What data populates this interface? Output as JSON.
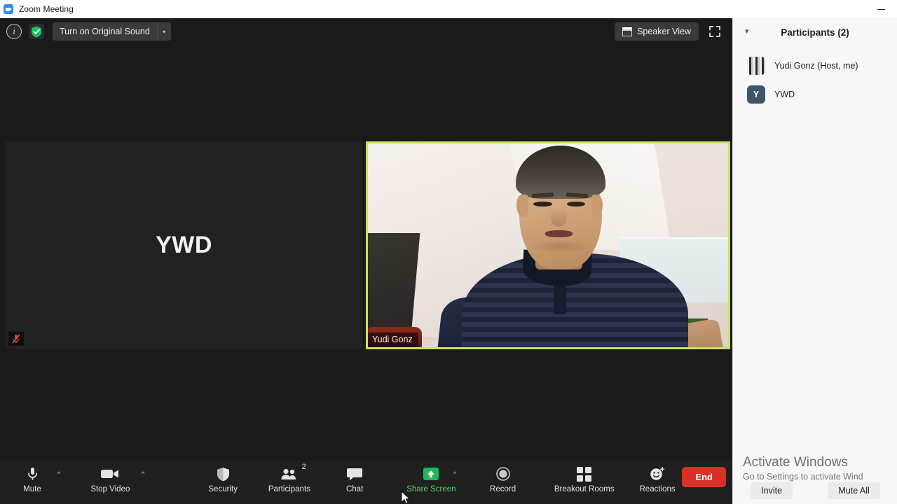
{
  "window": {
    "title": "Zoom Meeting",
    "app_icon": "zoom-camera-icon",
    "minimize_label": "Minimize"
  },
  "topbar": {
    "info_icon": "info-circle-icon",
    "info_label": "i",
    "security_icon": "shield-check-icon",
    "original_sound_label": "Turn on Original Sound",
    "original_sound_caret": "▾",
    "view_icon": "grid-view-icon",
    "view_label": "Speaker View",
    "fullscreen_icon": "fullscreen-icon"
  },
  "stage": {
    "tiles": [
      {
        "name": "YWD",
        "type": "initials",
        "initials": "YWD",
        "muted": true,
        "mute_icon": "microphone-muted-icon",
        "active_speaker": false
      },
      {
        "name": "Yudi Gonz",
        "type": "video",
        "name_tag": "Yudi Gonz",
        "muted": false,
        "active_speaker": true,
        "active_border_color": "#c9e265"
      }
    ]
  },
  "toolbar": {
    "items": [
      {
        "label": "Mute",
        "icon": "microphone-icon",
        "caret": "^",
        "has_caret": true,
        "badge": ""
      },
      {
        "label": "Stop Video",
        "icon": "video-camera-icon",
        "caret": "^",
        "has_caret": true,
        "badge": ""
      },
      {
        "label": "Security",
        "icon": "shield-icon",
        "caret": "",
        "has_caret": false,
        "badge": ""
      },
      {
        "label": "Participants",
        "icon": "people-icon",
        "caret": "",
        "has_caret": false,
        "badge": "2"
      },
      {
        "label": "Chat",
        "icon": "chat-bubble-icon",
        "caret": "",
        "has_caret": false,
        "badge": ""
      },
      {
        "label": "Share Screen",
        "icon": "share-screen-icon",
        "caret": "^",
        "has_caret": true,
        "badge": "",
        "highlight_color": "#5ad07a"
      },
      {
        "label": "Record",
        "icon": "record-circle-icon",
        "caret": "",
        "has_caret": false,
        "badge": ""
      },
      {
        "label": "Breakout Rooms",
        "icon": "breakout-rooms-icon",
        "caret": "",
        "has_caret": false,
        "badge": ""
      },
      {
        "label": "Reactions",
        "icon": "reactions-smiley-icon",
        "caret": "",
        "has_caret": false,
        "badge": ""
      }
    ],
    "end_label": "End",
    "end_color": "#d93025"
  },
  "participants_panel": {
    "collapse_icon": "chevron-down-icon",
    "title": "Participants (2)",
    "count": 2,
    "list": [
      {
        "name": "Yudi Gonz (Host, me)",
        "avatar_type": "photo",
        "avatar_letter": ""
      },
      {
        "name": "YWD",
        "avatar_type": "letter",
        "avatar_letter": "Y"
      }
    ],
    "footer": {
      "invite_label": "Invite",
      "mute_all_label": "Mute All"
    }
  },
  "watermark": {
    "title": "Activate Windows",
    "subtitle": "Go to Settings to activate Wind"
  }
}
